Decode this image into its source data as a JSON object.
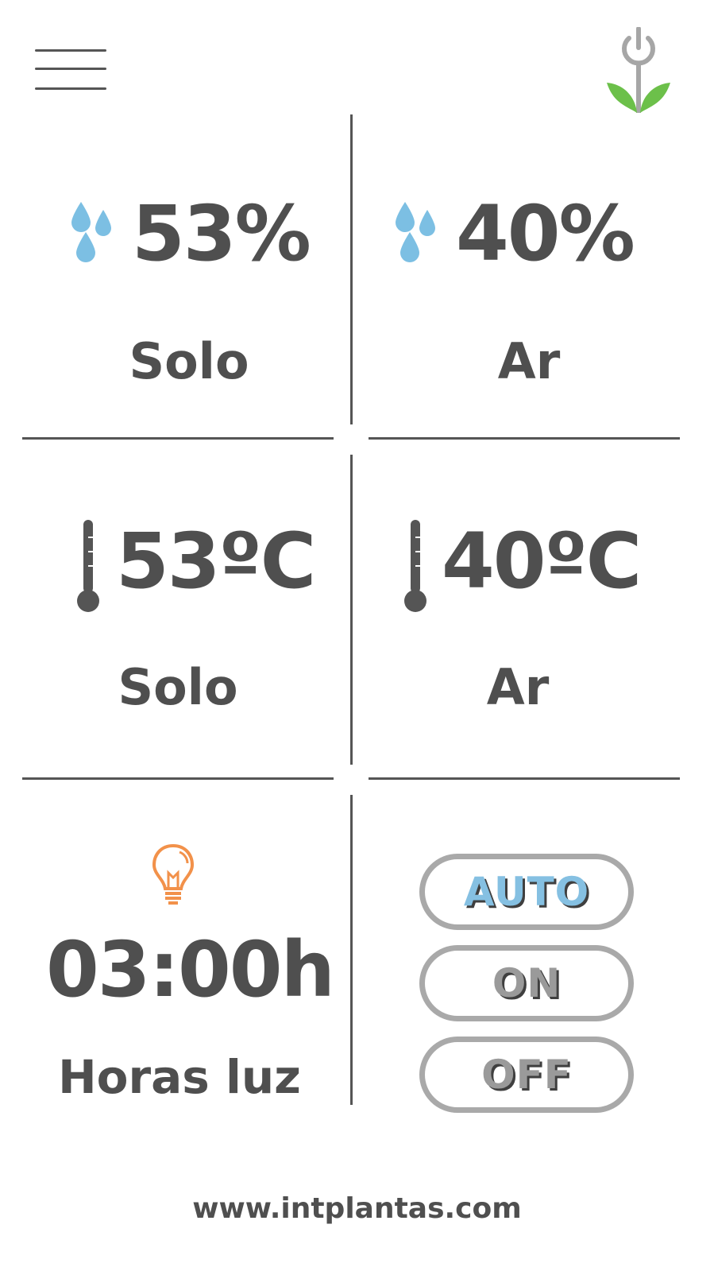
{
  "header": {
    "menu_icon": "hamburger-menu-icon",
    "logo_icon": "plant-power-logo-icon"
  },
  "cards": {
    "soil_humidity": {
      "value": "53%",
      "label": "Solo",
      "icon": "water-drops-icon"
    },
    "air_humidity": {
      "value": "40%",
      "label": "Ar",
      "icon": "water-drops-icon"
    },
    "soil_temperature": {
      "value": "53ºC",
      "label": "Solo",
      "icon": "thermometer-icon"
    },
    "air_temperature": {
      "value": "40ºC",
      "label": "Ar",
      "icon": "thermometer-icon"
    },
    "light_hours": {
      "value": "03:00h",
      "label": "Horas luz",
      "icon": "light-bulb-icon"
    }
  },
  "modes": {
    "auto_label": "AUTO",
    "on_label": "ON",
    "off_label": "OFF",
    "selected": "AUTO"
  },
  "footer": {
    "website": "www.intplantas.com"
  },
  "colors": {
    "text": "#4f4f4f",
    "water": "#7cbfe3",
    "bulb": "#f2914a",
    "leaf": "#6cc04a",
    "active_mode": "#85c0e2",
    "button_border": "#a9a9a9"
  }
}
